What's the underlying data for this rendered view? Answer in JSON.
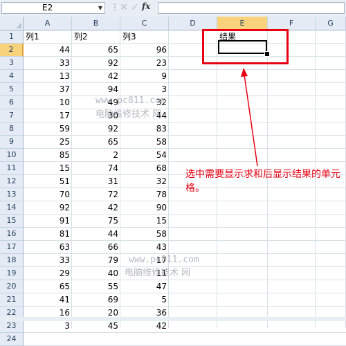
{
  "formula_bar": {
    "name_box": "E2",
    "fx_label": "fx",
    "formula": ""
  },
  "columns": [
    "A",
    "B",
    "C",
    "D",
    "E",
    "F",
    "G"
  ],
  "rows": [
    {
      "n": "1",
      "a": "列1",
      "b": "列2",
      "c": "列3",
      "e": "结果"
    },
    {
      "n": "2",
      "a": "44",
      "b": "65",
      "c": "96"
    },
    {
      "n": "3",
      "a": "33",
      "b": "92",
      "c": "23"
    },
    {
      "n": "4",
      "a": "13",
      "b": "42",
      "c": "9"
    },
    {
      "n": "5",
      "a": "37",
      "b": "94",
      "c": "3"
    },
    {
      "n": "6",
      "a": "10",
      "b": "49",
      "c": "32"
    },
    {
      "n": "7",
      "a": "17",
      "b": "30",
      "c": "44"
    },
    {
      "n": "8",
      "a": "59",
      "b": "92",
      "c": "83"
    },
    {
      "n": "9",
      "a": "25",
      "b": "65",
      "c": "58"
    },
    {
      "n": "10",
      "a": "85",
      "b": "2",
      "c": "54"
    },
    {
      "n": "11",
      "a": "15",
      "b": "74",
      "c": "68"
    },
    {
      "n": "12",
      "a": "51",
      "b": "31",
      "c": "32"
    },
    {
      "n": "13",
      "a": "70",
      "b": "72",
      "c": "78"
    },
    {
      "n": "14",
      "a": "92",
      "b": "42",
      "c": "90"
    },
    {
      "n": "15",
      "a": "91",
      "b": "75",
      "c": "15"
    },
    {
      "n": "16",
      "a": "81",
      "b": "44",
      "c": "58"
    },
    {
      "n": "17",
      "a": "63",
      "b": "66",
      "c": "43"
    },
    {
      "n": "18",
      "a": "33",
      "b": "79",
      "c": "17"
    },
    {
      "n": "19",
      "a": "29",
      "b": "40",
      "c": "11"
    },
    {
      "n": "20",
      "a": "65",
      "b": "55",
      "c": "47"
    },
    {
      "n": "21",
      "a": "41",
      "b": "69",
      "c": "5"
    },
    {
      "n": "22",
      "a": "16",
      "b": "20",
      "c": "36"
    },
    {
      "n": "23",
      "a": "3",
      "b": "45",
      "c": "42"
    },
    {
      "n": "24"
    }
  ],
  "selected_cell": "E2",
  "annotation": "选中需要显示求和后显示结果的单元格。",
  "watermarks": [
    {
      "url": "www.pc811.com",
      "name": "电脑维修技术 网"
    },
    {
      "url": "www.pc811.com",
      "name": "电脑维修技术 网"
    }
  ],
  "colors": {
    "annotation_red": "#e60012",
    "header_active": "#f8d37b"
  }
}
